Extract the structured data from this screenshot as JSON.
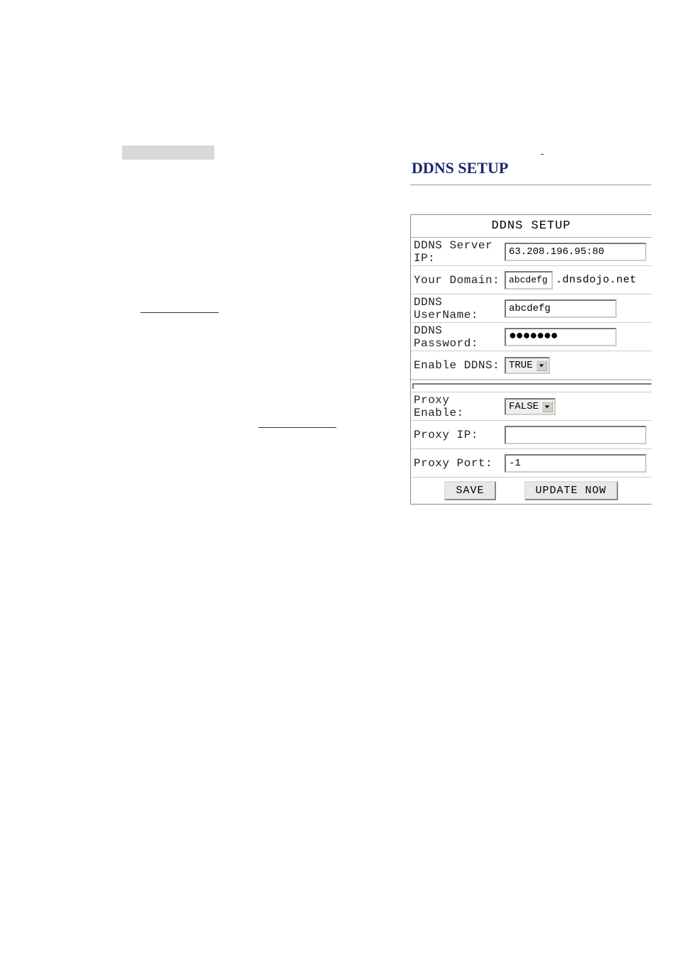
{
  "title": "DDNS SETUP",
  "panel_header": "DDNS SETUP",
  "rows": {
    "server_ip": {
      "label": "DDNS Server IP:",
      "value": "63.208.196.95:80"
    },
    "domain": {
      "label": "Your Domain:",
      "prefix": "abcdefg",
      "suffix": ".dnsdojo.net"
    },
    "username": {
      "label": "DDNS UserName:",
      "value": "abcdefg"
    },
    "password": {
      "label": "DDNS Password:",
      "value": "●●●●●●●"
    },
    "enable_ddns": {
      "label": "Enable DDNS:",
      "value": "TRUE"
    },
    "proxy_enable": {
      "label": "Proxy Enable:",
      "value": "FALSE"
    },
    "proxy_ip": {
      "label": "Proxy IP:",
      "value": ""
    },
    "proxy_port": {
      "label": "Proxy Port:",
      "value": "-1"
    }
  },
  "buttons": {
    "save": "SAVE",
    "update": "UPDATE NOW"
  },
  "dash": "-"
}
